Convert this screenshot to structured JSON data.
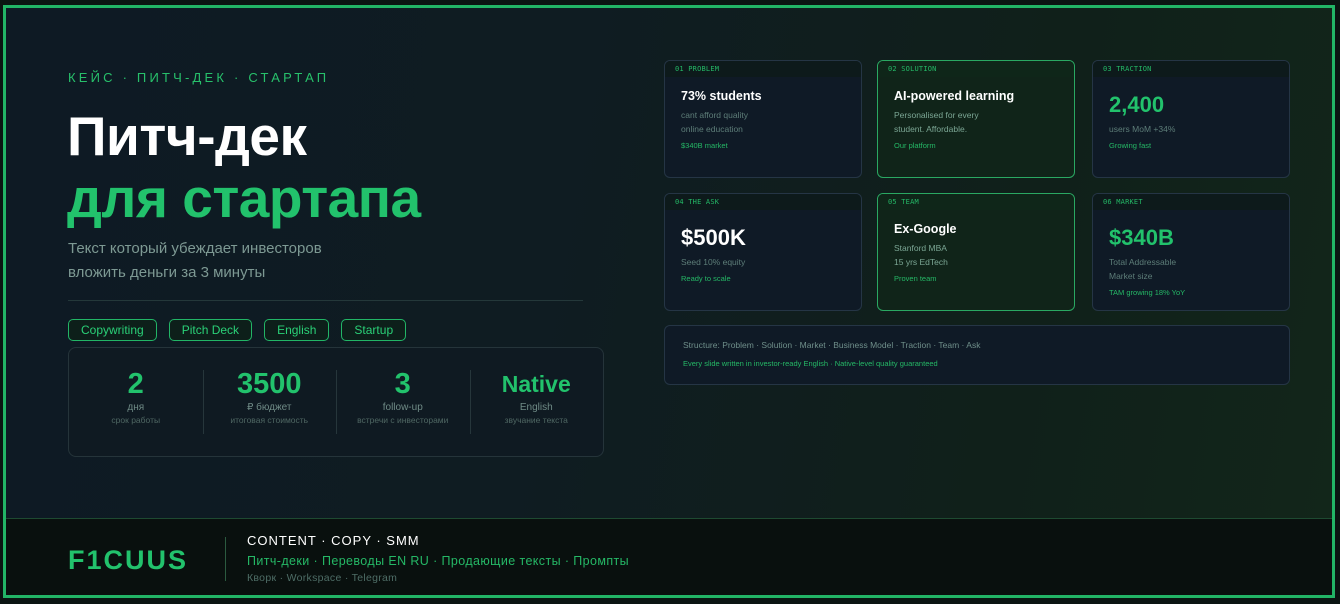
{
  "hero": {
    "eyebrow": "КЕЙС · ПИТЧ-ДЕК · СТАРТАП",
    "title_line1": "Питч-дек",
    "title_line2": "для стартапа",
    "subtitle_line1": "Текст который убеждает инвесторов",
    "subtitle_line2": "вложить деньги за 3 минуты"
  },
  "tags": [
    "Copywriting",
    "Pitch Deck",
    "English",
    "Startup"
  ],
  "stats": [
    {
      "value": "2",
      "label": "дня",
      "sub": "срок работы"
    },
    {
      "value": "3500",
      "label": "₽ бюджет",
      "sub": "итоговая стоимость"
    },
    {
      "value": "3",
      "label": "follow-up",
      "sub": "встречи с инвесторами"
    },
    {
      "value": "Native",
      "label": "English",
      "sub": "звучание текста"
    }
  ],
  "cards": [
    {
      "head": "01 PROBLEM",
      "title": "73% students",
      "desc1": "cant afford quality",
      "desc2": "online education",
      "note": "$340B market"
    },
    {
      "head": "02 SOLUTION",
      "title": "AI-powered learning",
      "desc1": "Personalised for every",
      "desc2": "student. Affordable.",
      "note": "Our platform"
    },
    {
      "head": "03 TRACTION",
      "title": "2,400",
      "desc1": "users MoM +34%",
      "note": "Growing fast"
    },
    {
      "head": "04 THE ASK",
      "title": "$500K",
      "desc1": "Seed 10% equity",
      "note": "Ready to scale"
    },
    {
      "head": "05 TEAM",
      "title": "Ex-Google",
      "desc1": "Stanford MBA",
      "desc2": "15 yrs EdTech",
      "note": "Proven team"
    },
    {
      "head": "06 MARKET",
      "title": "$340B",
      "desc1": "Total Addressable",
      "desc2": "Market size",
      "note": "TAM growing 18% YoY"
    }
  ],
  "structure": {
    "line": "Structure: Problem · Solution · Market · Business Model · Traction · Team · Ask",
    "note": "Every slide written in investor-ready English · Native-level quality guaranteed"
  },
  "footer": {
    "logo": "F1CUUS",
    "line1": "CONTENT · COPY · SMM",
    "line2": "Питч-деки · Переводы EN RU · Продающие тексты · Промпты",
    "line3": "Кворк · Workspace · Telegram"
  },
  "colors": {
    "accent": "#22c26c",
    "frame": "#22b566",
    "background": "#0e1a24"
  }
}
